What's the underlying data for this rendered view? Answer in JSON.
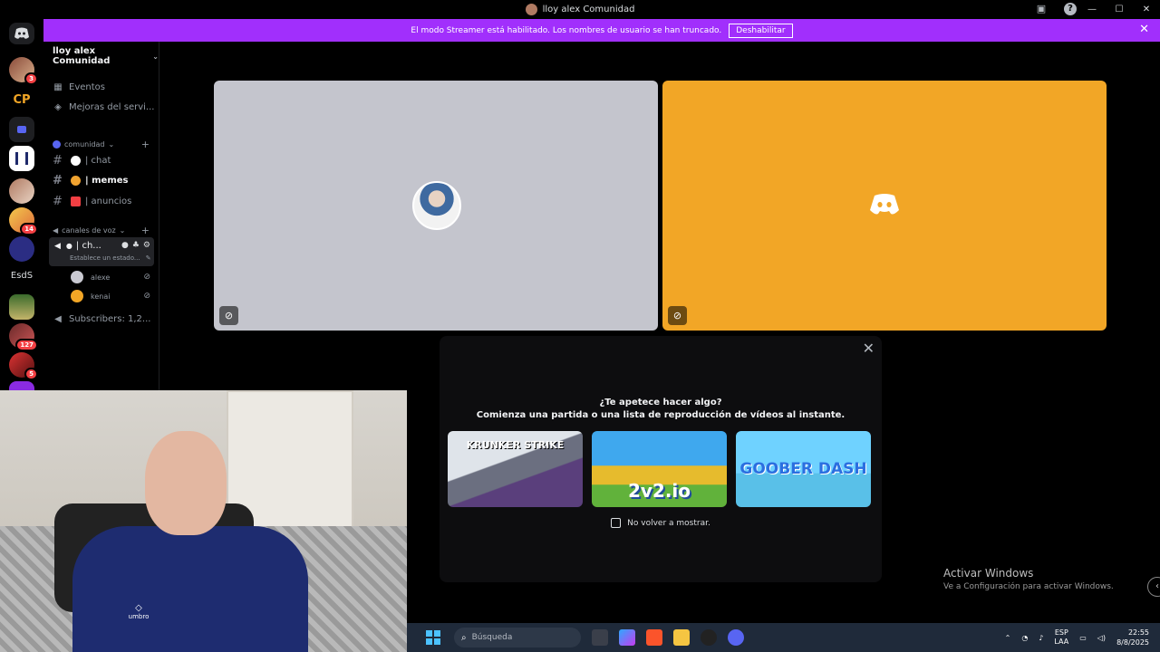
{
  "window": {
    "title": "lloy alex Comunidad"
  },
  "rail": {
    "badges": [
      "3",
      "14",
      "127",
      "5"
    ],
    "text_server": "EsdS"
  },
  "banner": {
    "message": "El modo Streamer está habilitado. Los nombres de usuario se han truncado.",
    "button_label": "Deshabilitar"
  },
  "sidebar": {
    "server_name": "lloy alex Comunidad",
    "top_items": [
      {
        "label": "Eventos",
        "icon": "calendar-icon"
      },
      {
        "label": "Mejoras del servi...",
        "icon": "boost-icon"
      }
    ],
    "categories": [
      {
        "label": "comunidad"
      },
      {
        "label": "canales de voz"
      }
    ],
    "text_channels": [
      {
        "label": "| chat",
        "emoji_color": "#ffffff"
      },
      {
        "label": "| memes",
        "emoji_color": "#f0a330"
      },
      {
        "label": "| anuncios",
        "emoji_color": "#f23f43"
      }
    ],
    "voice_channel": {
      "label": "| ch...",
      "status": "Establece un estado..."
    },
    "members": [
      {
        "name": "alexe",
        "avatar_color": "#c9c9d1"
      },
      {
        "name": "kenai",
        "avatar_color": "#f2a626"
      }
    ],
    "subscribers_channel": "Subscribers: 1,2..."
  },
  "popup": {
    "heading": "¿Te apetece hacer algo?",
    "subheading": "Comienza una partida o una lista de reproducción de vídeos al instante.",
    "games": [
      {
        "label": "KRUNKER STRIKE"
      },
      {
        "label": "2v2.io"
      },
      {
        "label": "GOOBER DASH"
      }
    ],
    "dont_show_label": "No volver a mostrar."
  },
  "webcam": {
    "shirt_logo": "umbro"
  },
  "desktop": {
    "activate_title": "Activar Windows",
    "activate_sub": "Ve a Configuración para activar Windows."
  },
  "taskbar": {
    "search_placeholder": "Búsqueda",
    "lang_top": "ESP",
    "lang_bottom": "LAA",
    "time": "22:55",
    "date": "8/8/2025"
  },
  "colors": {
    "banner": "#a12ffc",
    "tile_left": "#c4c5cd",
    "tile_right": "#f2a626",
    "badge": "#f23f43"
  }
}
